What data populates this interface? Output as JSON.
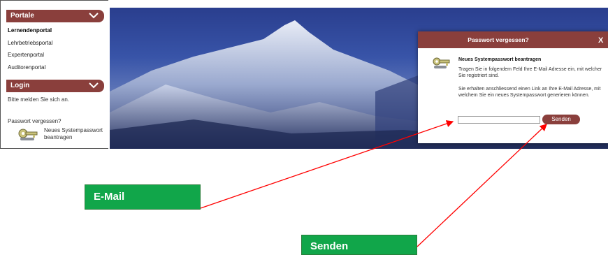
{
  "sidebar": {
    "portale_header": "Portale",
    "portal_links": [
      "Lernendenportal",
      "Lehrbetriebsportal",
      "Expertenportal",
      "Auditorenportal"
    ],
    "login_header": "Login",
    "login_prompt": "Bitte melden Sie sich an.",
    "forgot_label": "Passwort vergessen?",
    "new_password_link": "Neues Systempasswort beantragen"
  },
  "dialog": {
    "title": "Passwort vergessen?",
    "close": "X",
    "subtitle": "Neues Systempasswort beantragen",
    "text1": "Tragen Sie in folgendem Feld Ihre E-Mail Adresse ein, mit welcher Sie registriert sind.",
    "text2": "Sie erhalten anschliessend einen Link an Ihre E-Mail Adresse, mit welchem Sie ein neues Systempasswort generieren können.",
    "email_value": "",
    "send_label": "Senden"
  },
  "annotations": {
    "email_label": "E-Mail",
    "send_label": "Senden"
  },
  "colors": {
    "accent": "#8a3f3c",
    "callout": "#11a64a",
    "arrow": "#ff0000"
  }
}
